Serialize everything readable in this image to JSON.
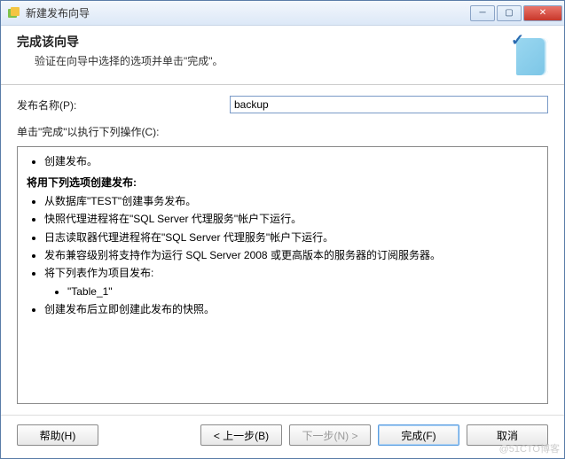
{
  "window": {
    "title": "新建发布向导"
  },
  "header": {
    "title": "完成该向导",
    "subtitle": "验证在向导中选择的选项并单击\"完成\"。"
  },
  "form": {
    "name_label": "发布名称(P):",
    "name_value": "backup",
    "actions_label": "单击\"完成\"以执行下列操作(C):"
  },
  "summary": {
    "line1": "创建发布。",
    "section_title": "将用下列选项创建发布:",
    "items": [
      "从数据库\"TEST\"创建事务发布。",
      "快照代理进程将在\"SQL Server 代理服务\"帐户下运行。",
      "日志读取器代理进程将在\"SQL Server 代理服务\"帐户下运行。",
      "发布兼容级别将支持作为运行 SQL Server 2008 或更高版本的服务器的订阅服务器。",
      "将下列表作为项目发布:"
    ],
    "subitems": [
      "\"Table_1\""
    ],
    "last": "创建发布后立即创建此发布的快照。"
  },
  "buttons": {
    "help": "帮助(H)",
    "back": "< 上一步(B)",
    "next": "下一步(N) >",
    "finish": "完成(F)",
    "cancel": "取消"
  },
  "watermark": "@51CTO博客"
}
